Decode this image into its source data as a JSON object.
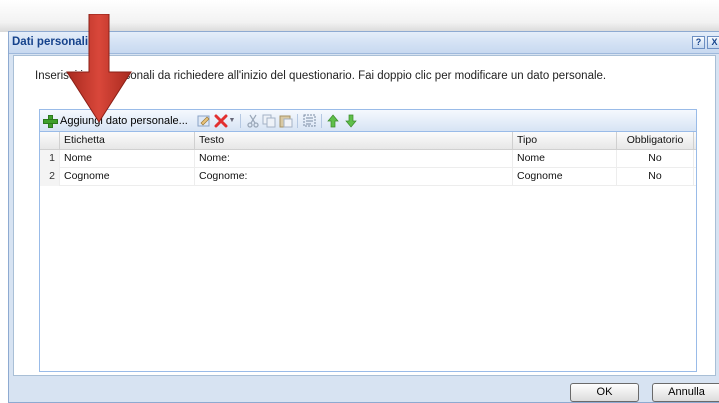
{
  "dialog": {
    "title": "Dati personali",
    "help_label": "?",
    "close_label": "X",
    "instructions": "Inserisci i dati personali da richiedere all'inizio del questionario. Fai doppio clic per modificare un dato personale."
  },
  "toolbar": {
    "add_label": "Aggiungi dato personale..."
  },
  "grid": {
    "columns": [
      "Etichetta",
      "Testo",
      "Tipo",
      "Obbligatorio"
    ],
    "rows": [
      {
        "num": "1",
        "etichetta": "Nome",
        "testo": "Nome:",
        "tipo": "Nome",
        "obbligatorio": "No"
      },
      {
        "num": "2",
        "etichetta": "Cognome",
        "testo": "Cognome:",
        "tipo": "Cognome",
        "obbligatorio": "No"
      }
    ]
  },
  "buttons": {
    "ok": "OK",
    "cancel": "Annulla"
  },
  "colors": {
    "title_text": "#15428b",
    "arrow": "#c0392b",
    "add_icon": "#3fa02c",
    "delete_icon": "#e23030"
  },
  "icons": [
    "add-icon",
    "edit-icon",
    "delete-icon",
    "cut-icon",
    "copy-icon",
    "paste-icon",
    "select-all-icon",
    "move-up-icon",
    "move-down-icon",
    "callout-arrow-icon"
  ]
}
